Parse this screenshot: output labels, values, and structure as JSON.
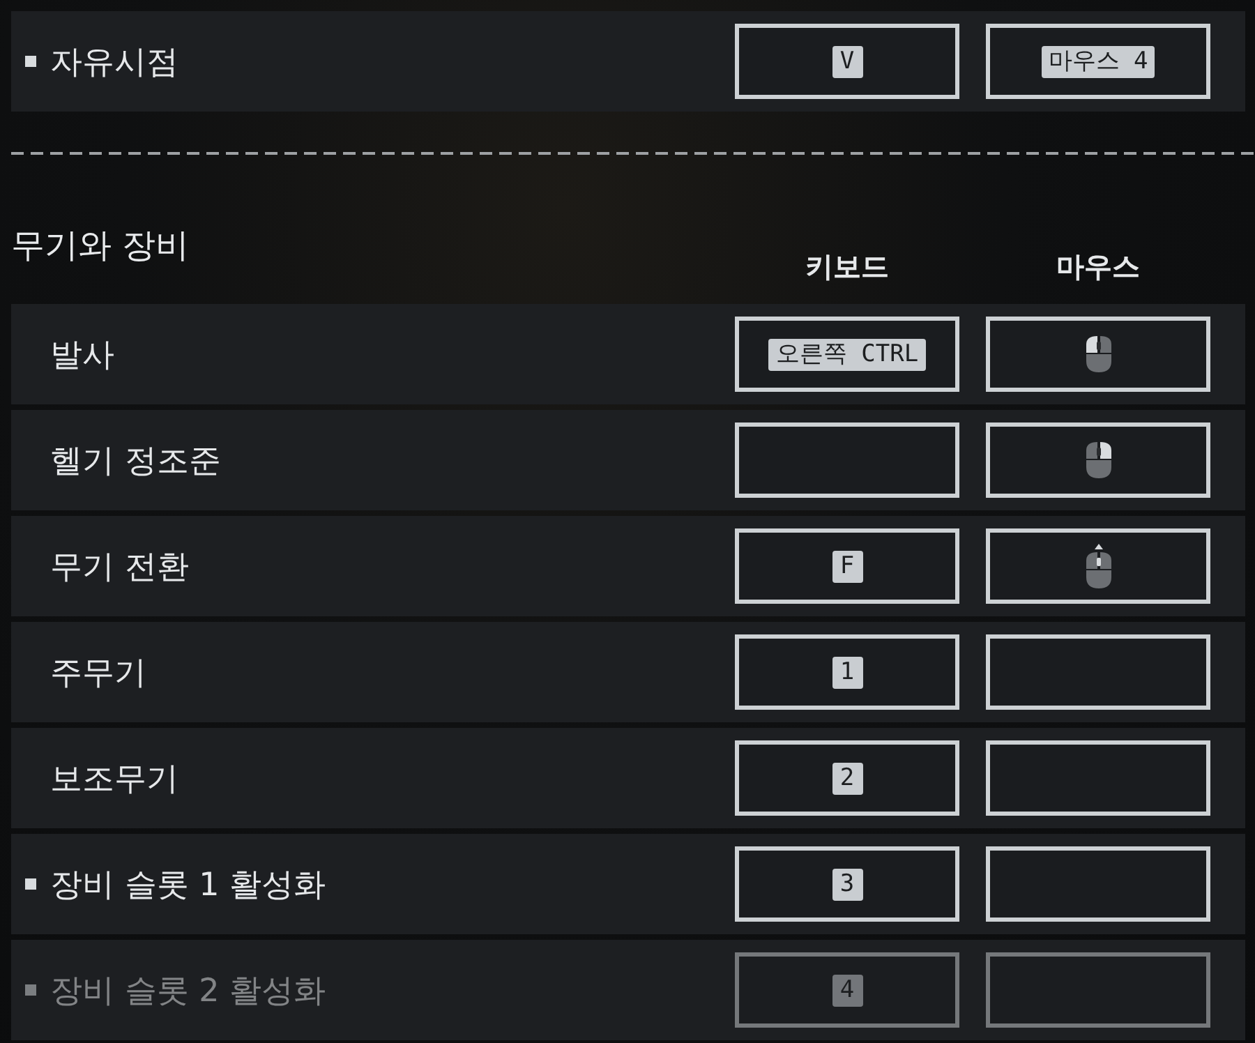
{
  "sections": [
    {
      "rows": [
        {
          "label": "자유시점",
          "marked": true,
          "dimmed": false,
          "keyboard": {
            "kind": "key",
            "label": "V"
          },
          "mouse": {
            "kind": "key",
            "label": "마우스 4"
          }
        }
      ]
    },
    {
      "title": "무기와 장비",
      "columns": [
        "키보드",
        "마우스"
      ],
      "rows": [
        {
          "label": "발사",
          "marked": false,
          "dimmed": false,
          "keyboard": {
            "kind": "key",
            "label": "오른쪽 CTRL"
          },
          "mouse": {
            "kind": "left-click"
          }
        },
        {
          "label": "헬기 정조준",
          "marked": false,
          "dimmed": false,
          "keyboard": {
            "kind": "empty"
          },
          "mouse": {
            "kind": "right-click"
          }
        },
        {
          "label": "무기 전환",
          "marked": false,
          "dimmed": false,
          "keyboard": {
            "kind": "key",
            "label": "F"
          },
          "mouse": {
            "kind": "wheel-up"
          }
        },
        {
          "label": "주무기",
          "marked": false,
          "dimmed": false,
          "keyboard": {
            "kind": "key",
            "label": "1"
          },
          "mouse": {
            "kind": "empty"
          }
        },
        {
          "label": "보조무기",
          "marked": false,
          "dimmed": false,
          "keyboard": {
            "kind": "key",
            "label": "2"
          },
          "mouse": {
            "kind": "empty"
          }
        },
        {
          "label": "장비 슬롯 1 활성화",
          "marked": true,
          "dimmed": false,
          "keyboard": {
            "kind": "key",
            "label": "3"
          },
          "mouse": {
            "kind": "empty"
          }
        },
        {
          "label": "장비 슬롯 2 활성화",
          "marked": true,
          "dimmed": true,
          "keyboard": {
            "kind": "key",
            "label": "4"
          },
          "mouse": {
            "kind": "empty"
          }
        }
      ]
    }
  ]
}
